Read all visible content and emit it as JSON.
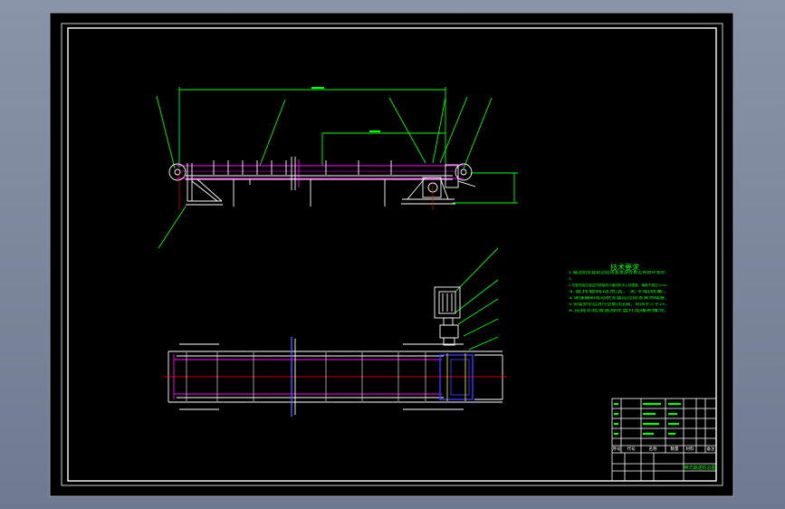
{
  "colors": {
    "sheet": "#000000",
    "border": "#ffffff",
    "leader": "#00ff00",
    "dim": "#00ff00",
    "part": "#ffffff",
    "belt": "#ff00ff",
    "center_line": "#ff0000",
    "blue": "#3a3aff",
    "yellow": "#ffff00",
    "viewport_bg": "#7c869b"
  },
  "tech_requirements": {
    "title": "技术要求",
    "lines": [
      "1.输送机安装前应检查各零部件是否有损坏变形，",
      "3.",
      "2.托辊安装应保证托辊轴线与输送机中心线垂直，偏差不超过1mm，",
      "3.各托辊转动灵活，无卡阻现象，",
      "4.减速器和电动机安装后应检查其同轴度，",
      "5.安装完毕后进行空载试运转，时间不少于2h，",
      "6.运转中检查各部件温升及噪声情况。"
    ]
  },
  "title_block": {
    "drawing_name": "带式输送机总图",
    "headers": [
      "序号",
      "代号",
      "名称",
      "数量",
      "材料",
      "备注"
    ]
  }
}
